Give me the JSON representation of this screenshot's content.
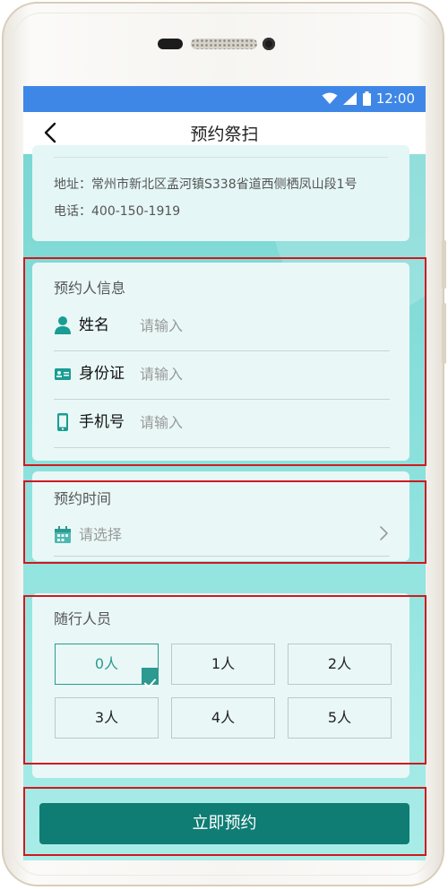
{
  "device": {
    "status_time": "12:00"
  },
  "header": {
    "title": "预约祭扫"
  },
  "address_card": {
    "address": "地址：常州市新北区孟河镇S338省道西侧栖凤山段1号",
    "phone": "电话：400-150-1919"
  },
  "booker_info": {
    "title": "预约人信息",
    "fields": [
      {
        "label": "姓名",
        "placeholder": "请输入",
        "icon": "person-icon"
      },
      {
        "label": "身份证",
        "placeholder": "请输入",
        "icon": "id-card-icon"
      },
      {
        "label": "手机号",
        "placeholder": "请输入",
        "icon": "mobile-phone-icon"
      }
    ]
  },
  "booking_time": {
    "title": "预约时间",
    "placeholder": "请选择",
    "icon": "calendar-icon"
  },
  "companions": {
    "title": "随行人员",
    "options": [
      "0人",
      "1人",
      "2人",
      "3人",
      "4人",
      "5人"
    ],
    "selected": "0人"
  },
  "submit": {
    "label": "立即预约"
  },
  "colors": {
    "status_bar": "#3f87e7",
    "accent": "#2b9a90",
    "submit_button": "#0f7d74",
    "highlight_box": "#d0191e",
    "page_background": "#7fd9d6"
  }
}
